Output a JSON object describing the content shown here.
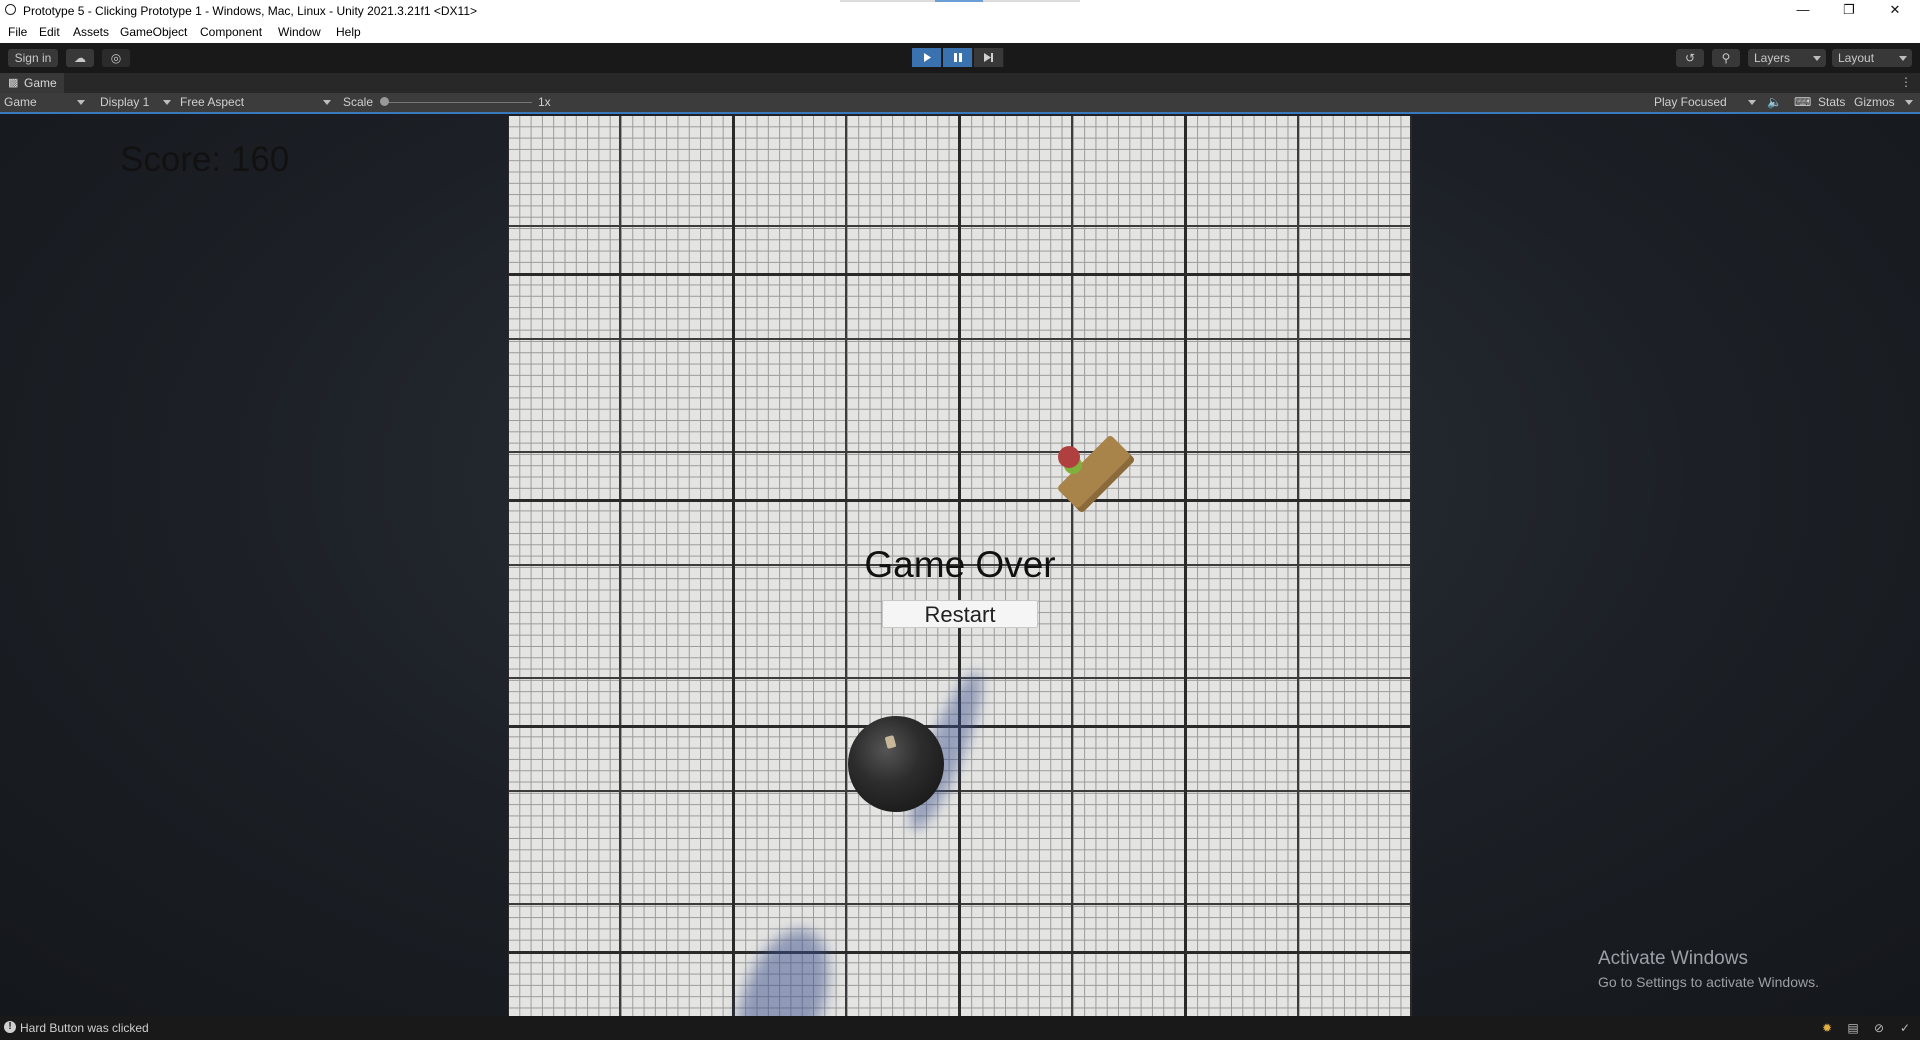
{
  "window": {
    "title": "Prototype 5 - Clicking Prototype 1 - Windows, Mac, Linux - Unity 2021.3.21f1 <DX11>",
    "minimize_icon": "minimize-icon",
    "maximize_icon": "restore-icon",
    "close_icon": "close-icon"
  },
  "menu": [
    "File",
    "Edit",
    "Assets",
    "GameObject",
    "Component",
    "Window",
    "Help"
  ],
  "toolbar": {
    "sign_in": "Sign in",
    "cloud_icon": "cloud-icon",
    "collab_icon": "collab-icon",
    "play_icon": "play-icon",
    "pause_icon": "pause-icon",
    "step_icon": "step-icon",
    "history_icon": "history-icon",
    "search_icon": "search-icon",
    "layers": "Layers",
    "layout": "Layout",
    "play_state": "playing"
  },
  "tab": {
    "icon": "gamepad-icon",
    "label": "Game"
  },
  "game_controls": {
    "view": "Game",
    "display": "Display 1",
    "aspect": "Free Aspect",
    "scale_label": "Scale",
    "scale_value": "1x",
    "play_mode": "Play Focused",
    "audio_icon": "speaker-icon",
    "keyboard_icon": "keyboard-icon",
    "stats": "Stats",
    "gizmos": "Gizmos"
  },
  "game": {
    "score": "Score: 160",
    "game_over": "Game Over",
    "restart": "Restart",
    "objects": [
      "bomb",
      "food"
    ]
  },
  "watermark": {
    "line1": "Activate Windows",
    "line2": "Go to Settings to activate Windows."
  },
  "status": {
    "message": "Hard Button was clicked",
    "icons": [
      "bug-icon",
      "console-icon",
      "network-icon",
      "check-icon"
    ]
  }
}
